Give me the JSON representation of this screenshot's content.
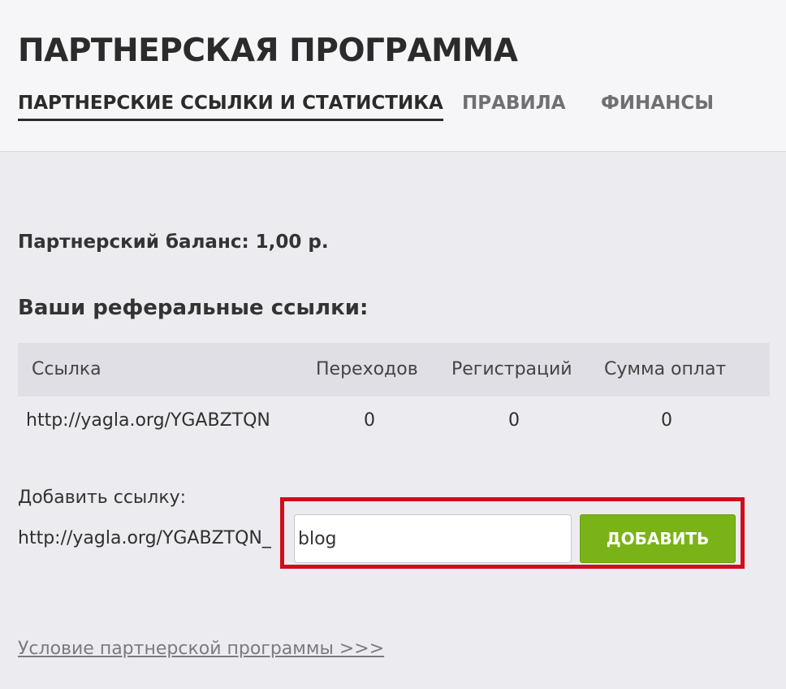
{
  "header": {
    "title": "ПАРТНЕРСКАЯ ПРОГРАММА",
    "tabs": [
      {
        "label": "ПАРТНЕРСКИЕ ССЫЛКИ И СТАТИСТИКА",
        "active": true
      },
      {
        "label": "ПРАВИЛА",
        "active": false
      },
      {
        "label": "ФИНАНСЫ",
        "active": false
      }
    ]
  },
  "balance": "Партнерский баланс: 1,00 р.",
  "links_section": {
    "title": "Ваши реферальные ссылки:",
    "columns": [
      "Ссылка",
      "Переходов",
      "Регистраций",
      "Сумма оплат"
    ],
    "rows": [
      [
        "http://yagla.org/YGABZTQN",
        "0",
        "0",
        "0"
      ]
    ]
  },
  "add_link": {
    "label": "Добавить ссылку:",
    "prefix": "http://yagla.org/YGABZTQN_",
    "input_value": "blog",
    "button_label": "ДОБАВИТЬ"
  },
  "terms_link": "Условие партнерской программы >>>",
  "colors": {
    "accent_button": "#7ab317",
    "highlight_border": "#d10d1c"
  }
}
